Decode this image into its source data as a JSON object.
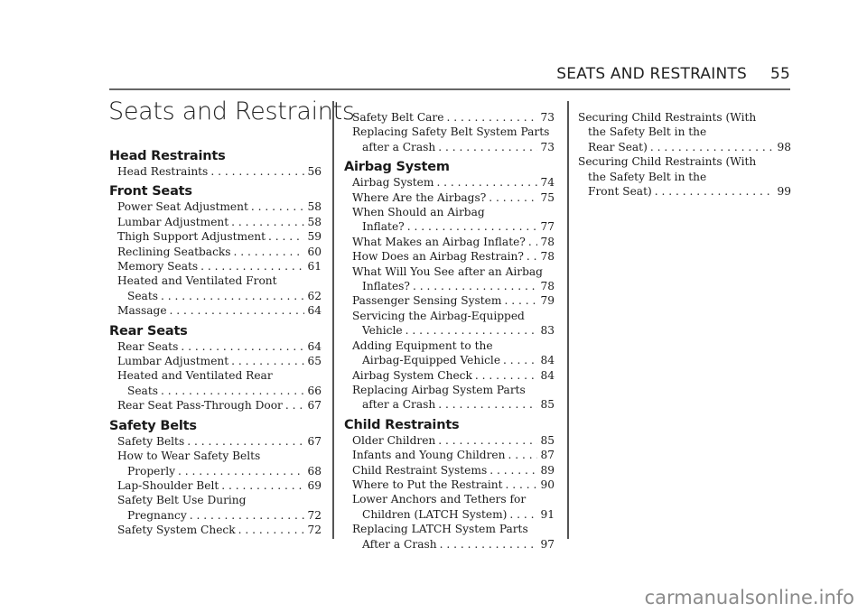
{
  "header": {
    "section": "SEATS AND RESTRAINTS",
    "page": "55"
  },
  "title": "Seats and Restraints",
  "columns": [
    [
      {
        "heading": "Head Restraints",
        "entries": [
          {
            "lines": [
              "Head Restraints"
            ],
            "page": "56"
          }
        ]
      },
      {
        "heading": "Front Seats",
        "entries": [
          {
            "lines": [
              "Power Seat Adjustment"
            ],
            "page": "58"
          },
          {
            "lines": [
              "Lumbar Adjustment"
            ],
            "page": "58"
          },
          {
            "lines": [
              "Thigh Support Adjustment"
            ],
            "page": "59"
          },
          {
            "lines": [
              "Reclining Seatbacks"
            ],
            "page": "60"
          },
          {
            "lines": [
              "Memory Seats"
            ],
            "page": "61"
          },
          {
            "lines": [
              "Heated and Ventilated Front",
              "Seats"
            ],
            "page": "62"
          },
          {
            "lines": [
              "Massage"
            ],
            "page": "64"
          }
        ]
      },
      {
        "heading": "Rear Seats",
        "entries": [
          {
            "lines": [
              "Rear Seats"
            ],
            "page": "64"
          },
          {
            "lines": [
              "Lumbar Adjustment"
            ],
            "page": "65"
          },
          {
            "lines": [
              "Heated and Ventilated Rear",
              "Seats"
            ],
            "page": "66"
          },
          {
            "lines": [
              "Rear Seat Pass-Through Door"
            ],
            "page": "67"
          }
        ]
      },
      {
        "heading": "Safety Belts",
        "entries": [
          {
            "lines": [
              "Safety Belts"
            ],
            "page": "67"
          },
          {
            "lines": [
              "How to Wear Safety Belts",
              "Properly"
            ],
            "page": "68"
          },
          {
            "lines": [
              "Lap-Shoulder Belt"
            ],
            "page": "69"
          },
          {
            "lines": [
              "Safety Belt Use During",
              "Pregnancy"
            ],
            "page": "72"
          },
          {
            "lines": [
              "Safety System Check"
            ],
            "page": "72"
          }
        ]
      }
    ],
    [
      {
        "heading": "",
        "entries": [
          {
            "lines": [
              "Safety Belt Care"
            ],
            "page": "73"
          },
          {
            "lines": [
              "Replacing Safety Belt System Parts",
              "after a Crash"
            ],
            "page": "73"
          }
        ]
      },
      {
        "heading": "Airbag System",
        "entries": [
          {
            "lines": [
              "Airbag System"
            ],
            "page": "74"
          },
          {
            "lines": [
              "Where Are the Airbags?"
            ],
            "page": "75"
          },
          {
            "lines": [
              "When Should an Airbag",
              "Inflate?"
            ],
            "page": "77"
          },
          {
            "lines": [
              "What Makes an Airbag Inflate?"
            ],
            "page": "78"
          },
          {
            "lines": [
              "How Does an Airbag Restrain?"
            ],
            "page": "78"
          },
          {
            "lines": [
              "What Will You See after an Airbag",
              "Inflates?"
            ],
            "page": "78"
          },
          {
            "lines": [
              "Passenger Sensing System"
            ],
            "page": "79"
          },
          {
            "lines": [
              "Servicing the Airbag-Equipped",
              "Vehicle"
            ],
            "page": "83"
          },
          {
            "lines": [
              "Adding Equipment to the",
              "Airbag-Equipped Vehicle"
            ],
            "page": "84"
          },
          {
            "lines": [
              "Airbag System Check"
            ],
            "page": "84"
          },
          {
            "lines": [
              "Replacing Airbag System Parts",
              "after a Crash"
            ],
            "page": "85"
          }
        ]
      },
      {
        "heading": "Child Restraints",
        "entries": [
          {
            "lines": [
              "Older Children"
            ],
            "page": "85"
          },
          {
            "lines": [
              "Infants and Young Children"
            ],
            "page": "87"
          },
          {
            "lines": [
              "Child Restraint Systems"
            ],
            "page": "89"
          },
          {
            "lines": [
              "Where to Put the Restraint"
            ],
            "page": "90"
          },
          {
            "lines": [
              "Lower Anchors and Tethers for",
              "Children (LATCH System)"
            ],
            "page": "91"
          },
          {
            "lines": [
              "Replacing LATCH System Parts",
              "After a Crash"
            ],
            "page": "97"
          }
        ]
      }
    ],
    [
      {
        "heading": "",
        "entries": [
          {
            "lines": [
              "Securing Child Restraints (With",
              "the Safety Belt in the",
              "Rear Seat)"
            ],
            "page": "98"
          },
          {
            "lines": [
              "Securing Child Restraints (With",
              "the Safety Belt in the",
              "Front Seat)"
            ],
            "page": "99"
          }
        ]
      }
    ]
  ],
  "watermark": "carmanualsonline.info"
}
